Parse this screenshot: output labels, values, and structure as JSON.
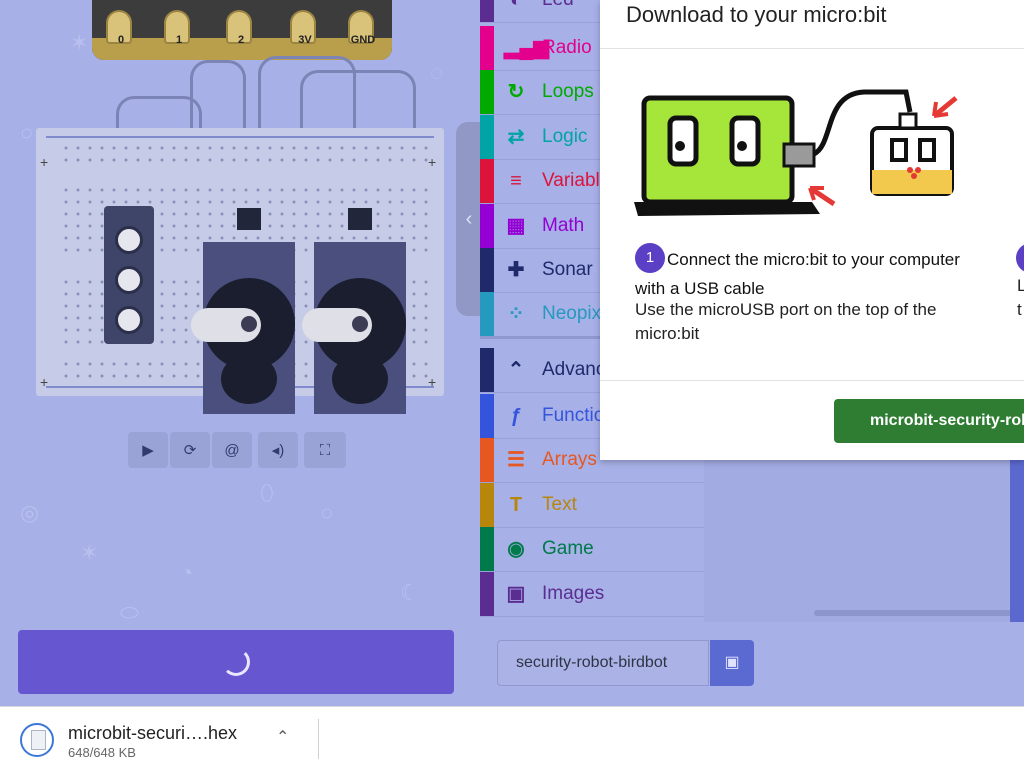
{
  "simulator": {
    "pins": [
      "0",
      "1",
      "2",
      "3V",
      "GND"
    ],
    "toolbar": [
      {
        "name": "play-icon",
        "glyph": "▶"
      },
      {
        "name": "restart-icon",
        "glyph": "⟳"
      },
      {
        "name": "slow-mo-icon",
        "glyph": "🐌"
      },
      {
        "name": "mute-icon",
        "glyph": "🔊"
      },
      {
        "name": "fullscreen-icon",
        "glyph": "⛶"
      }
    ]
  },
  "toolbox": {
    "categories": [
      {
        "label": "Led",
        "icon": "toggle-icon",
        "glyph": "◐",
        "color": "#5c2d91"
      },
      {
        "label": "Radio",
        "icon": "signal-icon",
        "glyph": "▂▄▆",
        "color": "#e3008c"
      },
      {
        "label": "Loops",
        "icon": "refresh-icon",
        "glyph": "↻",
        "color": "#00aa00"
      },
      {
        "label": "Logic",
        "icon": "shuffle-icon",
        "glyph": "⇄",
        "color": "#00a4a6"
      },
      {
        "label": "Variables",
        "icon": "list-icon",
        "glyph": "≡",
        "color": "#dc143c"
      },
      {
        "label": "Math",
        "icon": "calculator-icon",
        "glyph": "▦",
        "color": "#9400d3"
      },
      {
        "label": "Sonar",
        "icon": "puzzle-icon",
        "glyph": "✚",
        "color": "#1f2a6b"
      },
      {
        "label": "Neopixel",
        "icon": "neopixel-icon",
        "glyph": "⁘",
        "color": "#2699bf"
      },
      {
        "label": "Advanced",
        "icon": "chevron-up-icon",
        "glyph": "⌃",
        "color": "#1f2a6b"
      },
      {
        "label": "Functions",
        "icon": "function-icon",
        "glyph": "ƒ",
        "color": "#3455db"
      },
      {
        "label": "Arrays",
        "icon": "numbered-list-icon",
        "glyph": "☰",
        "color": "#e65722"
      },
      {
        "label": "Text",
        "icon": "text-icon",
        "glyph": "T",
        "color": "#b8860b"
      },
      {
        "label": "Game",
        "icon": "gamepad-icon",
        "glyph": "◉",
        "color": "#007a4b"
      },
      {
        "label": "Images",
        "icon": "image-icon",
        "glyph": "▣",
        "color": "#5c2d91"
      }
    ]
  },
  "editor": {
    "project_name": "security-robot-birdbot",
    "save_icon": "save-icon"
  },
  "modal": {
    "title": "Download to your micro:bit",
    "step_number": "1",
    "step_title": "Connect the micro:bit to your computer with a USB cable",
    "step_description": "Use the microUSB port on the top of the micro:bit",
    "next_step_line1": "L",
    "next_step_line2": "t",
    "filename_button": "microbit-security-robot-birdbot.hex"
  },
  "download_bar": {
    "filename": "microbit-securi….hex",
    "size": "648/648 KB"
  },
  "colors": {
    "overlay": "#a7b0e7",
    "download_button": "#6657d1",
    "step_badge": "#5b3fc4",
    "filename_button": "#2e7d32"
  }
}
